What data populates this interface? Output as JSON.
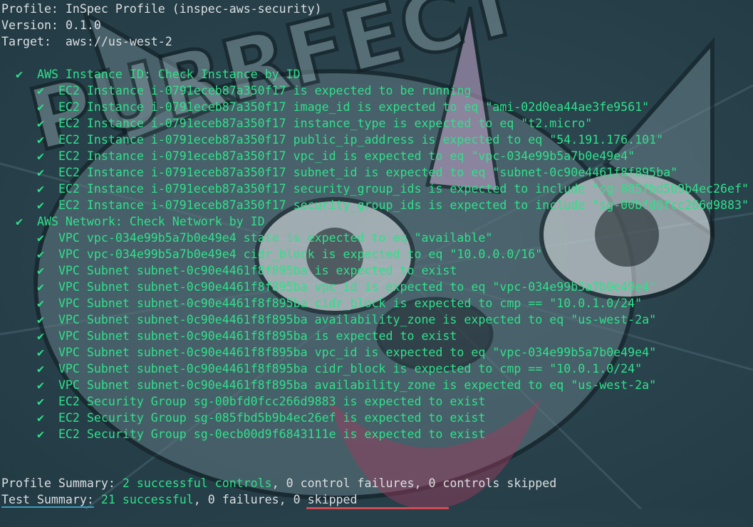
{
  "header": {
    "profile_label": "Profile:",
    "profile_value": "InSpec Profile (inspec-aws-security)",
    "version_label": "Version:",
    "version_value": "0.1.0",
    "target_label": "Target:",
    "target_value": "aws://us-west-2"
  },
  "check_glyph": "✔",
  "controls": [
    {
      "title": "AWS Instance ID: Check Instance by ID",
      "results": [
        "EC2 Instance i-0791eceb87a350f17 is expected to be running",
        "EC2 Instance i-0791eceb87a350f17 image_id is expected to eq \"ami-02d0ea44ae3fe9561\"",
        "EC2 Instance i-0791eceb87a350f17 instance_type is expected to eq \"t2.micro\"",
        "EC2 Instance i-0791eceb87a350f17 public_ip_address is expected to eq \"54.191.176.101\"",
        "EC2 Instance i-0791eceb87a350f17 vpc_id is expected to eq \"vpc-034e99b5a7b0e49e4\"",
        "EC2 Instance i-0791eceb87a350f17 subnet_id is expected to eq \"subnet-0c90e4461f8f895ba\"",
        "EC2 Instance i-0791eceb87a350f17 security_group_ids is expected to include \"sg-085fbd5b9b4ec26ef\"",
        "EC2 Instance i-0791eceb87a350f17 security_group_ids is expected to include \"sg-00bfd0fcc266d9883\""
      ]
    },
    {
      "title": "AWS Network: Check Network by ID",
      "results": [
        "VPC vpc-034e99b5a7b0e49e4 state is expected to eq \"available\"",
        "VPC vpc-034e99b5a7b0e49e4 cidr_block is expected to eq \"10.0.0.0/16\"",
        "VPC Subnet subnet-0c90e4461f8f895ba is expected to exist",
        "VPC Subnet subnet-0c90e4461f8f895ba vpc_id is expected to eq \"vpc-034e99b5a7b0e49e4\"",
        "VPC Subnet subnet-0c90e4461f8f895ba cidr_block is expected to cmp == \"10.0.1.0/24\"",
        "VPC Subnet subnet-0c90e4461f8f895ba availability_zone is expected to eq \"us-west-2a\"",
        "VPC Subnet subnet-0c90e4461f8f895ba is expected to exist",
        "VPC Subnet subnet-0c90e4461f8f895ba vpc_id is expected to eq \"vpc-034e99b5a7b0e49e4\"",
        "VPC Subnet subnet-0c90e4461f8f895ba cidr_block is expected to cmp == \"10.0.1.0/24\"",
        "VPC Subnet subnet-0c90e4461f8f895ba availability_zone is expected to eq \"us-west-2a\"",
        "EC2 Security Group sg-00bfd0fcc266d9883 is expected to exist",
        "EC2 Security Group sg-085fbd5b9b4ec26ef is expected to exist",
        "EC2 Security Group sg-0ecb00d9f6843111e is expected to exist"
      ]
    }
  ],
  "summary": {
    "profile_label": "Profile Summary:",
    "profile_success": "2 successful controls",
    "profile_rest": ", 0 control failures, 0 controls skipped",
    "test_label": "Test Summary:",
    "test_success": "21 successful",
    "test_rest": ", 0 failures, 0 skipped"
  },
  "wallpaper": {
    "text": "PURRFECT",
    "icon": "cat-wallpaper-icon"
  },
  "colors": {
    "pass_green": "#2fe08a",
    "text": "#dcdfe2",
    "background": "#2a434d",
    "accent_cyan": "#3a9ec2",
    "accent_red": "#d14b55"
  }
}
